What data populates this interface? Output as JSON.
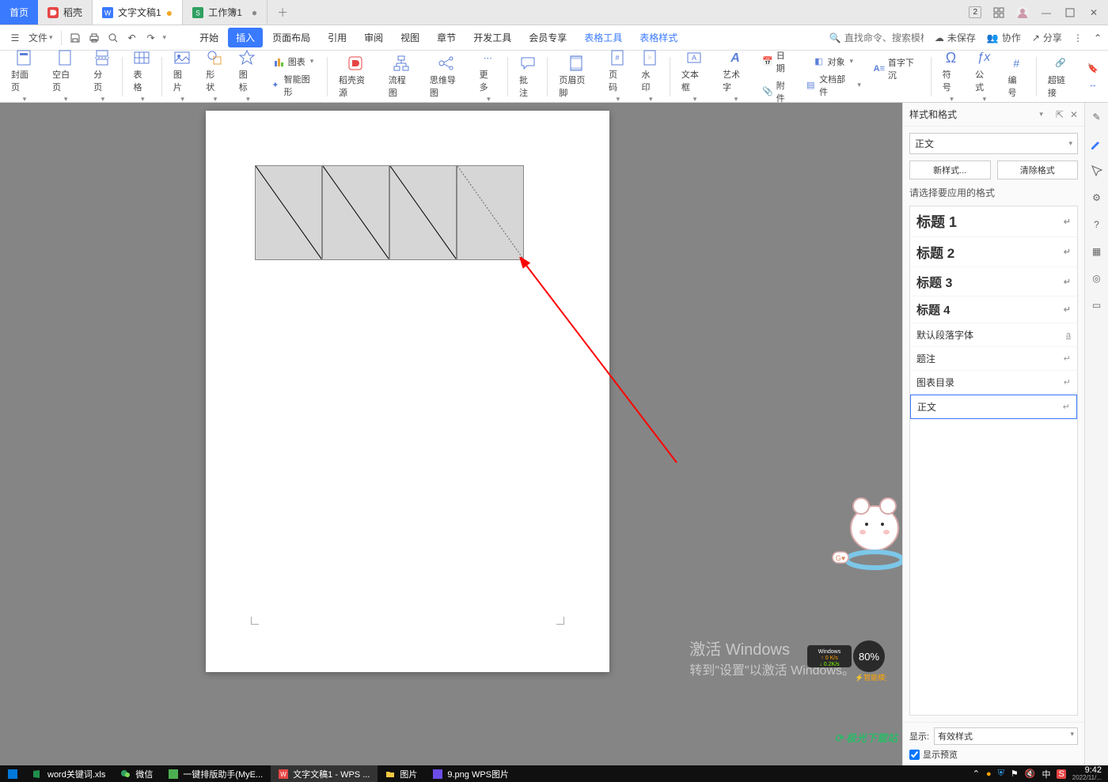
{
  "tabs": {
    "home": "首页",
    "dock": "稻壳",
    "doc": "文字文稿1",
    "sheet": "工作簿1"
  },
  "window": {
    "badge": "2"
  },
  "qa": {
    "file": "文件"
  },
  "menutabs": {
    "start": "开始",
    "insert": "插入",
    "page": "页面布局",
    "ref": "引用",
    "review": "审阅",
    "view": "视图",
    "chapter": "章节",
    "dev": "开发工具",
    "member": "会员专享",
    "tabletool": "表格工具",
    "tablestyle": "表格样式"
  },
  "topright": {
    "search_placeholder": "直找命令、搜索模板",
    "unsaved": "未保存",
    "coop": "协作",
    "share": "分享"
  },
  "ribbon": {
    "cover": "封面页",
    "blank": "空白页",
    "pagebreak": "分页",
    "table": "表格",
    "picture": "图片",
    "shape": "形状",
    "icon": "图标",
    "chart": "图表",
    "smart": "智能图形",
    "dock_res": "稻壳资源",
    "flow": "流程图",
    "mind": "思维导图",
    "more": "更多",
    "comment": "批注",
    "headerfooter": "页眉页脚",
    "pagenum": "页码",
    "watermark": "水印",
    "textbox": "文本框",
    "wordart": "艺术字",
    "date": "日期",
    "object": "对象",
    "attach": "附件",
    "dropcap": "首字下沉",
    "docpart": "文档部件",
    "symbol": "符号",
    "formula": "公式",
    "number": "编号",
    "hyperlink": "超链接"
  },
  "panel": {
    "title": "样式和格式",
    "current": "正文",
    "new_style": "新样式...",
    "clear": "清除格式",
    "hint": "请选择要应用的格式",
    "styles": {
      "h1": "标题 1",
      "h2": "标题 2",
      "h3": "标题 3",
      "h4": "标题 4",
      "default": "默认段落字体",
      "caption": "题注",
      "toc": "图表目录",
      "body": "正文"
    },
    "show_label": "显示:",
    "show_value": "有效样式",
    "preview": "显示预览"
  },
  "watermark": {
    "line1": "激活 Windows",
    "line2": "转到\"设置\"以激活 Windows。"
  },
  "netbadge": {
    "label": "Windows",
    "speed1": "0 K/s",
    "speed2": "0.2 K/s",
    "pct": "80%",
    "smart": "智能模式"
  },
  "logo": "极光下载站",
  "taskbar": {
    "items": [
      "word关键词.xls",
      "微信",
      "一键排版助手(MyE...",
      "文字文稿1 - WPS ...",
      "图片",
      "9.png  WPS图片"
    ],
    "time": "9:42",
    "date": "2022/11/..."
  }
}
